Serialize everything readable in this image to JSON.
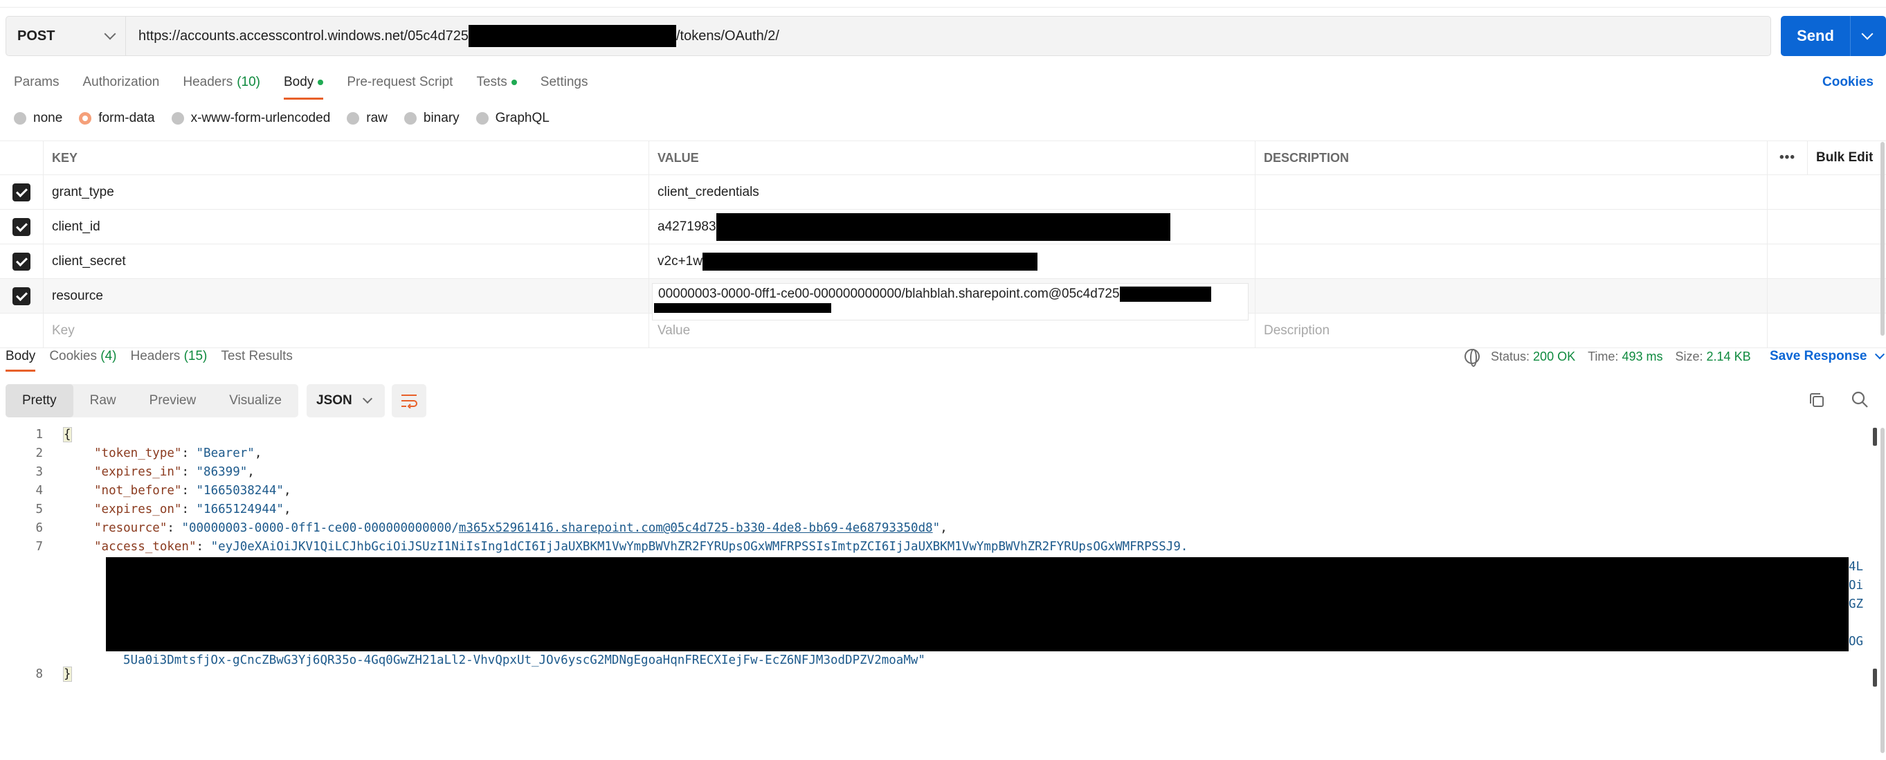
{
  "request": {
    "method": "POST",
    "url_prefix": "https://accounts.accesscontrol.windows.net/05c4d725",
    "url_suffix": "/tokens/OAuth/2/",
    "send_label": "Send"
  },
  "tabs": [
    {
      "label": "Params"
    },
    {
      "label": "Authorization"
    },
    {
      "label": "Headers",
      "count": "(10)"
    },
    {
      "label": "Body",
      "active": true
    },
    {
      "label": "Pre-request Script"
    },
    {
      "label": "Tests"
    },
    {
      "label": "Settings"
    }
  ],
  "cookies_link": "Cookies",
  "body_types": [
    "none",
    "form-data",
    "x-www-form-urlencoded",
    "raw",
    "binary",
    "GraphQL"
  ],
  "body_type_selected": "form-data",
  "table": {
    "headers": {
      "key": "KEY",
      "value": "VALUE",
      "description": "DESCRIPTION",
      "bulk_edit": "Bulk Edit",
      "more": "•••"
    },
    "rows": [
      {
        "key": "grant_type",
        "value": "client_credentials",
        "checked": true
      },
      {
        "key": "client_id",
        "value": "a4271983",
        "checked": true
      },
      {
        "key": "client_secret",
        "value": "v2c+1w",
        "checked": true
      },
      {
        "key": "resource",
        "value": "00000003-0000-0ff1-ce00-000000000000/blahblah.sharepoint.com@05c4d725",
        "checked": true
      }
    ],
    "placeholders": {
      "key": "Key",
      "value": "Value",
      "description": "Description"
    }
  },
  "response": {
    "tabs": [
      {
        "label": "Body",
        "active": true
      },
      {
        "label": "Cookies",
        "count": "(4)"
      },
      {
        "label": "Headers",
        "count": "(15)"
      },
      {
        "label": "Test Results"
      }
    ],
    "status_label": "Status:",
    "status_value": "200 OK",
    "time_label": "Time:",
    "time_value": "493 ms",
    "size_label": "Size:",
    "size_value": "2.14 KB",
    "save_label": "Save Response",
    "views": [
      "Pretty",
      "Raw",
      "Preview",
      "Visualize"
    ],
    "view_selected": "Pretty",
    "format": "JSON"
  },
  "code": {
    "line_numbers": [
      "1",
      "2",
      "3",
      "4",
      "5",
      "6",
      "7",
      "8"
    ],
    "open_brace": "{",
    "close_brace": "}",
    "token_type_key": "\"token_type\"",
    "token_type_val": "\"Bearer\"",
    "expires_in_key": "\"expires_in\"",
    "expires_in_val": "\"86399\"",
    "not_before_key": "\"not_before\"",
    "not_before_val": "\"1665038244\"",
    "expires_on_key": "\"expires_on\"",
    "expires_on_val": "\"1665124944\"",
    "resource_key": "\"resource\"",
    "resource_val_a": "\"00000003-0000-0ff1-ce00-000000000000/",
    "resource_val_link": "m365x52961416.sharepoint.com@05c4d725-b330-4de8-bb69-4e68793350d8",
    "resource_val_b": "\"",
    "access_token_key": "\"access_token\"",
    "access_token_val": "\"eyJ0eXAiOiJKV1QiLCJhbGciOiJSUzI1NiIsIng1dCI6IjJaUXBKM1VwYmpBWVhZR2FYRUpsOGxWMFRPSSIsImtpZCI6IjJaUXBKM1VwYmpBWVhZR2FYRUpsOGxWMFRPSSJ9.",
    "edge_1": "4L",
    "edge_2": "Oi",
    "edge_3": "GZ",
    "edge_4": "OG",
    "access_token_tail": "5Ua0i3DmtsfjOx-gCncZBwG3Yj6QR35o-4Gq0GwZH21aLl2-VhvQpxUt_JOv6yscG2MDNgEgoaHqnFRECXIejFw-EcZ6NFJM3odDPZV2moaMw\""
  },
  "colors": {
    "accent": "#e8612a",
    "send": "#0b66d5",
    "ok": "#0e8a3e",
    "tab_dot": "#1faa53"
  }
}
